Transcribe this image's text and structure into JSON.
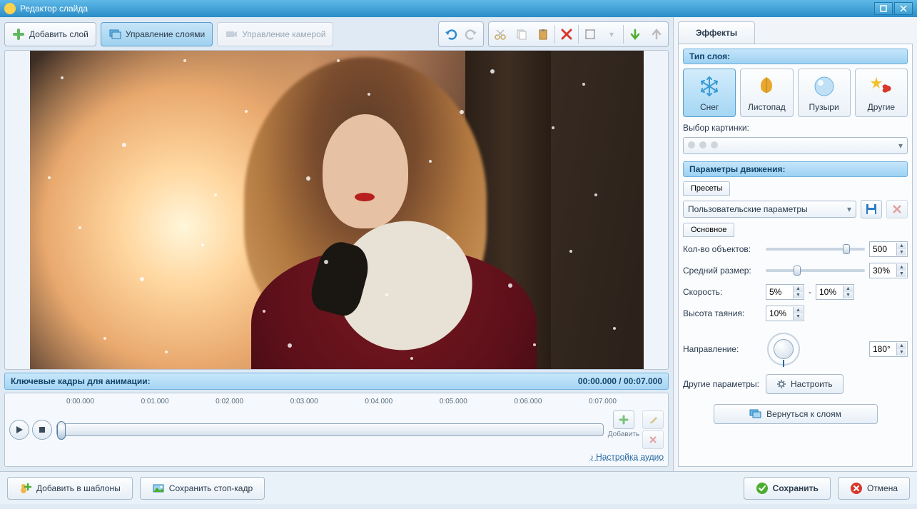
{
  "window": {
    "title": "Редактор слайда"
  },
  "toolbar": {
    "add_layer": "Добавить слой",
    "manage_layers": "Управление слоями",
    "camera_control": "Управление камерой"
  },
  "timeline": {
    "header": "Ключевые кадры для анимации:",
    "time_display": "00:00.000 / 00:07.000",
    "ticks": [
      "0:00.000",
      "0:01.000",
      "0:02.000",
      "0:03.000",
      "0:04.000",
      "0:05.000",
      "0:06.000",
      "0:07.000"
    ],
    "add_label": "Добавить",
    "audio_link": "Настройка аудио"
  },
  "effects": {
    "tab": "Эффекты",
    "section_type": "Тип слоя:",
    "types": {
      "snow": "Снег",
      "leaf": "Листопад",
      "bubble": "Пузыри",
      "other": "Другие"
    },
    "image_select": "Выбор картинки:",
    "section_motion": "Параметры движения:",
    "presets_tab": "Пресеты",
    "preset_value": "Пользовательские параметры",
    "main_tab": "Основное",
    "labels": {
      "count": "Кол-во объектов:",
      "size": "Средний размер:",
      "speed": "Скорость:",
      "melt": "Высота таяния:",
      "direction": "Направление:",
      "other_params": "Другие параметры:"
    },
    "values": {
      "count": "500",
      "size": "30%",
      "speed_min": "5%",
      "speed_max": "10%",
      "melt": "10%",
      "direction": "180°"
    },
    "configure_btn": "Настроить",
    "return_layers": "Вернуться к слоям"
  },
  "bottom": {
    "add_template": "Добавить в шаблоны",
    "save_frame": "Сохранить стоп-кадр",
    "save": "Сохранить",
    "cancel": "Отмена"
  }
}
